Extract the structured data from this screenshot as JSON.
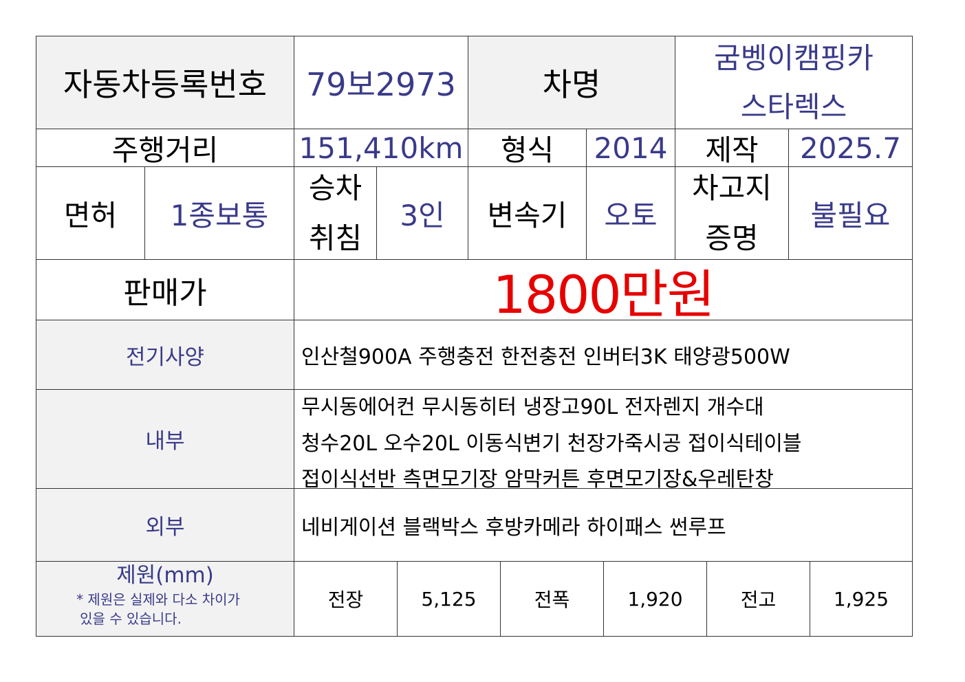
{
  "row1": {
    "reg_label": "자동차등록번호",
    "reg_value": "79보2973",
    "name_label": "차명",
    "name_value_line1": "굼벵이캠핑카",
    "name_value_line2": "스타렉스"
  },
  "row2": {
    "mileage_label": "주행거리",
    "mileage_value": "151,410km",
    "type_label": "형식",
    "type_value": "2014",
    "make_label": "제작",
    "make_value": "2025.7"
  },
  "row3": {
    "license_label": "면허",
    "license_value": "1종보통",
    "riding_label_line1": "승차",
    "riding_label_line2": "취침",
    "riding_value": "3인",
    "trans_label": "변속기",
    "trans_value": "오토",
    "garage_label_line1": "차고지",
    "garage_label_line2": "증명",
    "garage_value": "불필요"
  },
  "price": {
    "label": "판매가",
    "value": "1800만원",
    "color": "#e60000"
  },
  "electric": {
    "label": "전기사양",
    "text": "인산철900A 주행충전 한전충전 인버터3K 태양광500W"
  },
  "interior": {
    "label": "내부",
    "lines": [
      "무시동에어컨 무시동히터 냉장고90L 전자렌지 개수대",
      "청수20L 오수20L 이동식변기 천장가죽시공 접이식테이블",
      "접이식선반 측면모기장 암막커튼 후면모기장&우레탄창"
    ]
  },
  "exterior": {
    "label": "외부",
    "text": "네비게이션 블랙박스 후방카메라 하이패스 썬루프"
  },
  "dimensions": {
    "label": "제원(mm)",
    "note_line1": "* 제원은 실제와 다소 차이가",
    "note_line2": "있을 수 있습니다.",
    "length_label": "전장",
    "length_value": "5,125",
    "width_label": "전폭",
    "width_value": "1,920",
    "height_label": "전고",
    "height_value": "1,925"
  },
  "colors": {
    "header_bg": "#f2f2f2",
    "value_text": "#3a3a8a",
    "price_text": "#e60000"
  }
}
